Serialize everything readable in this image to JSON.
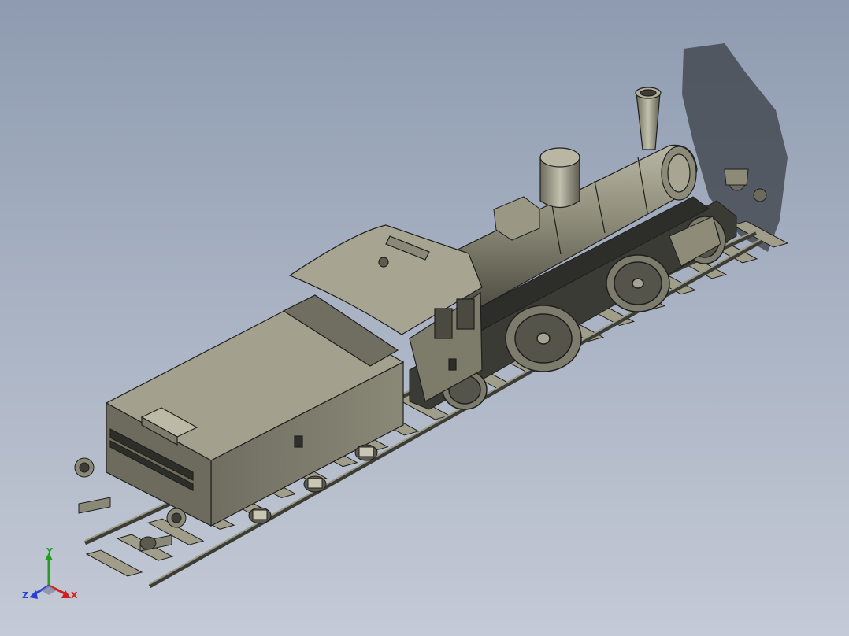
{
  "viewport": {
    "background_top": "#8e9bb0",
    "background_bottom": "#c4cad6"
  },
  "model": {
    "shading_color": "#8c8a78",
    "edge_color": "#1f1f1f",
    "shadow_color": "#3a3f46"
  },
  "triad": {
    "x_label": "X",
    "y_label": "Y",
    "z_label": "Z",
    "x_color": "#d11f1f",
    "y_color": "#1ea01e",
    "z_color": "#2a3fd6"
  }
}
